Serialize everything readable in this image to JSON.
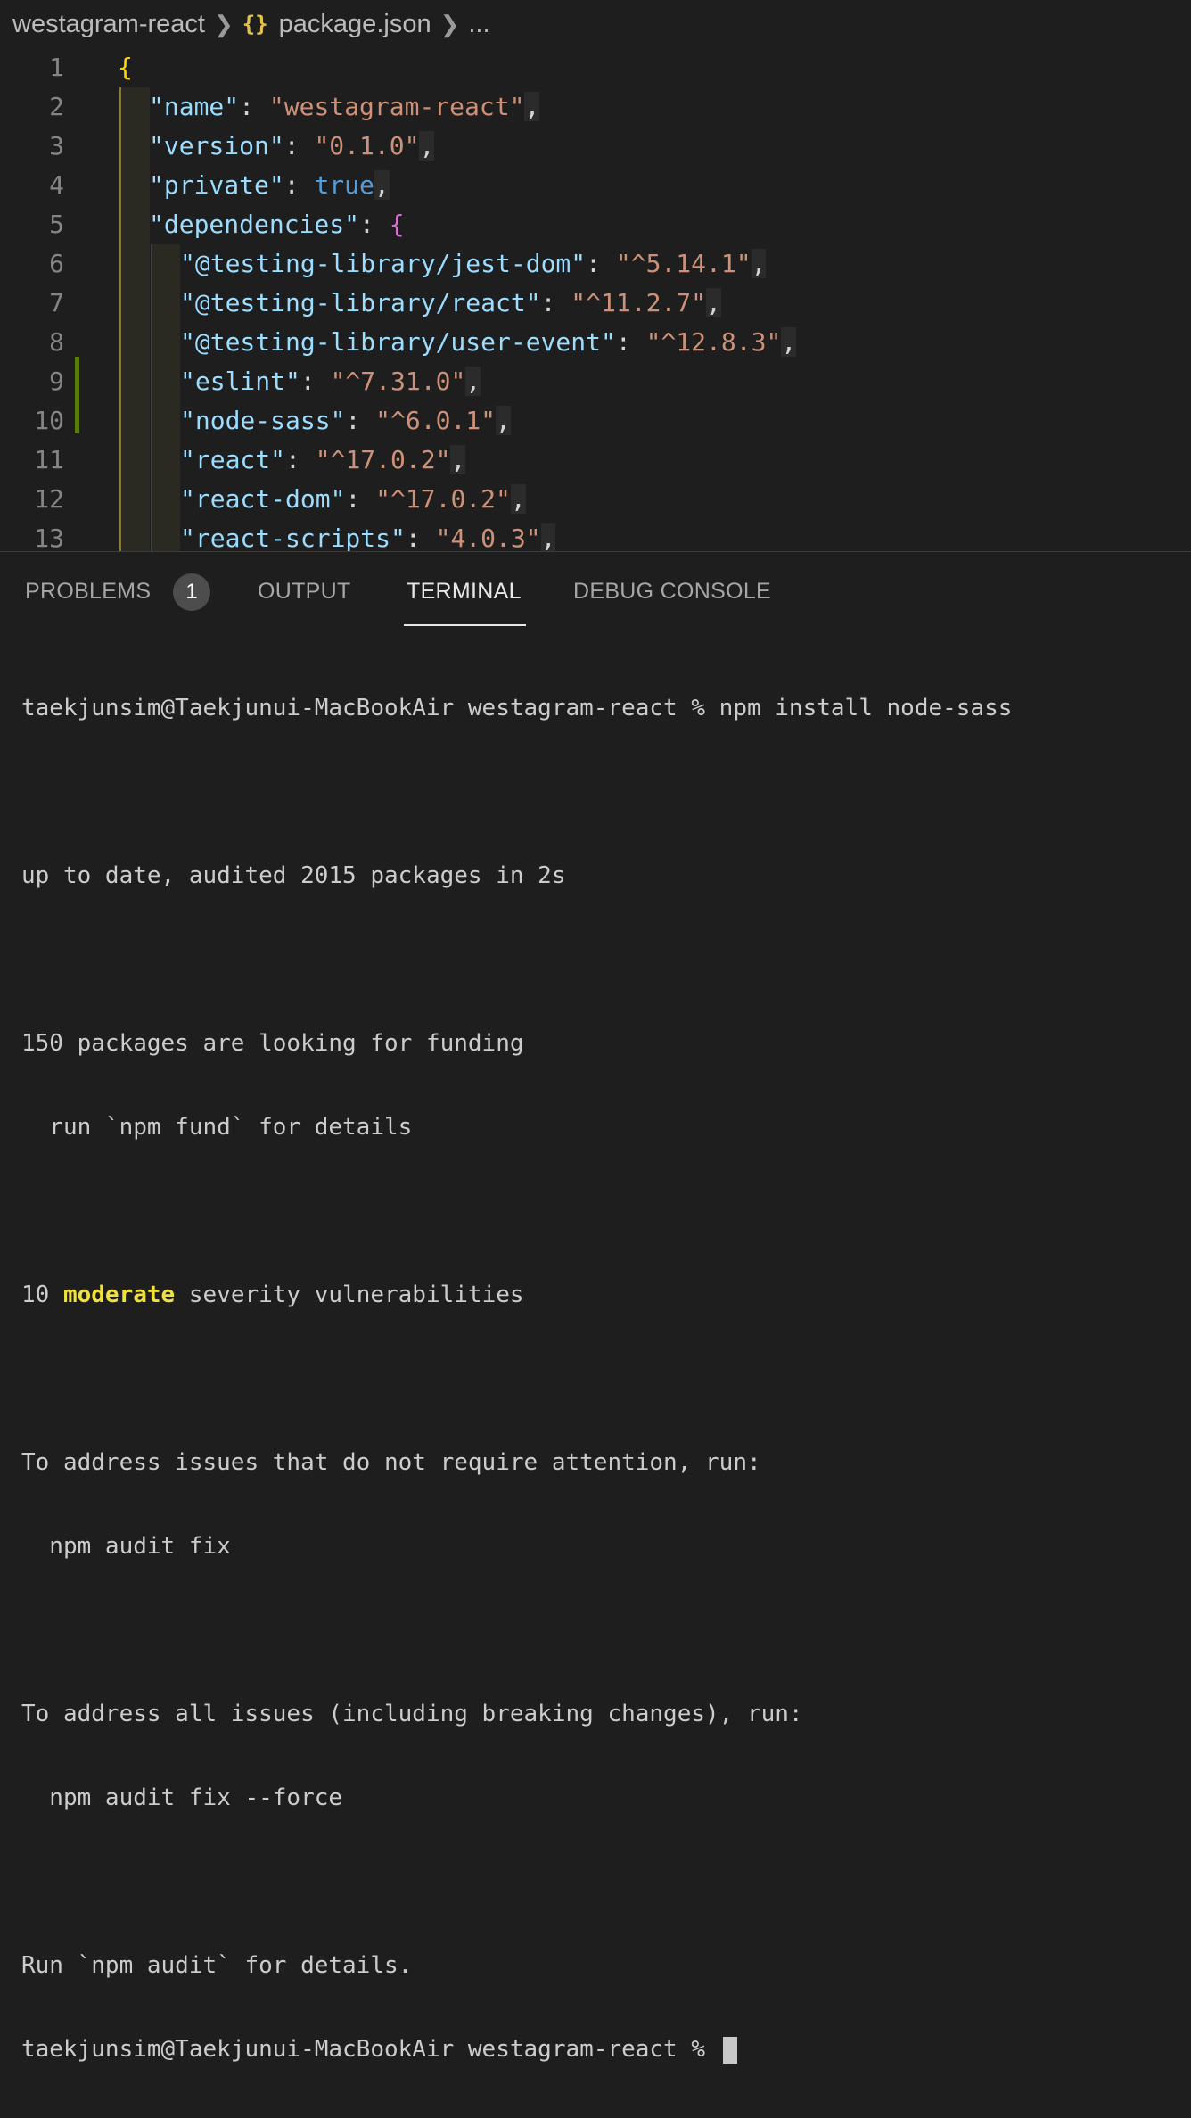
{
  "breadcrumb": {
    "folder": "westagram-react",
    "file_icon": "{}",
    "file": "package.json",
    "more": "..."
  },
  "editor": {
    "lines": [
      {
        "n": "1"
      },
      {
        "n": "2",
        "key": "\"name\"",
        "value": "\"westagram-react\""
      },
      {
        "n": "3",
        "key": "\"version\"",
        "value": "\"0.1.0\""
      },
      {
        "n": "4",
        "key": "\"private\"",
        "value": "true"
      },
      {
        "n": "5",
        "key": "\"dependencies\""
      },
      {
        "n": "6",
        "key": "\"@testing-library/jest-dom\"",
        "value": "\"^5.14.1\""
      },
      {
        "n": "7",
        "key": "\"@testing-library/react\"",
        "value": "\"^11.2.7\""
      },
      {
        "n": "8",
        "key": "\"@testing-library/user-event\"",
        "value": "\"^12.8.3\""
      },
      {
        "n": "9",
        "key": "\"eslint\"",
        "value": "\"^7.31.0\""
      },
      {
        "n": "10",
        "key": "\"node-sass\"",
        "value": "\"^6.0.1\""
      },
      {
        "n": "11",
        "key": "\"react\"",
        "value": "\"^17.0.2\""
      },
      {
        "n": "12",
        "key": "\"react-dom\"",
        "value": "\"^17.0.2\""
      },
      {
        "n": "13",
        "key": "\"react-scripts\"",
        "value": "\"4.0.3\""
      }
    ]
  },
  "panel": {
    "tabs": {
      "problems": "PROBLEMS",
      "problems_count": "1",
      "output": "OUTPUT",
      "terminal": "TERMINAL",
      "debug_console": "DEBUG CONSOLE"
    },
    "terminal": {
      "prompt1": "taekjunsim@Taekjunui-MacBookAir westagram-react % npm install node-sass",
      "l_uptodate": "up to date, audited 2015 packages in 2s",
      "l_funding1": "150 packages are looking for funding",
      "l_funding2": "  run `npm fund` for details",
      "l_vuln_count": "10 ",
      "l_vuln_level": "moderate",
      "l_vuln_rest": " severity vulnerabilities",
      "l_addr1": "To address issues that do not require attention, run:",
      "l_addr1_cmd": "  npm audit fix",
      "l_addr2": "To address all issues (including breaking changes), run:",
      "l_addr2_cmd": "  npm audit fix --force",
      "l_run": "Run `npm audit` for details.",
      "prompt2": "taekjunsim@Taekjunui-MacBookAir westagram-react % "
    }
  }
}
